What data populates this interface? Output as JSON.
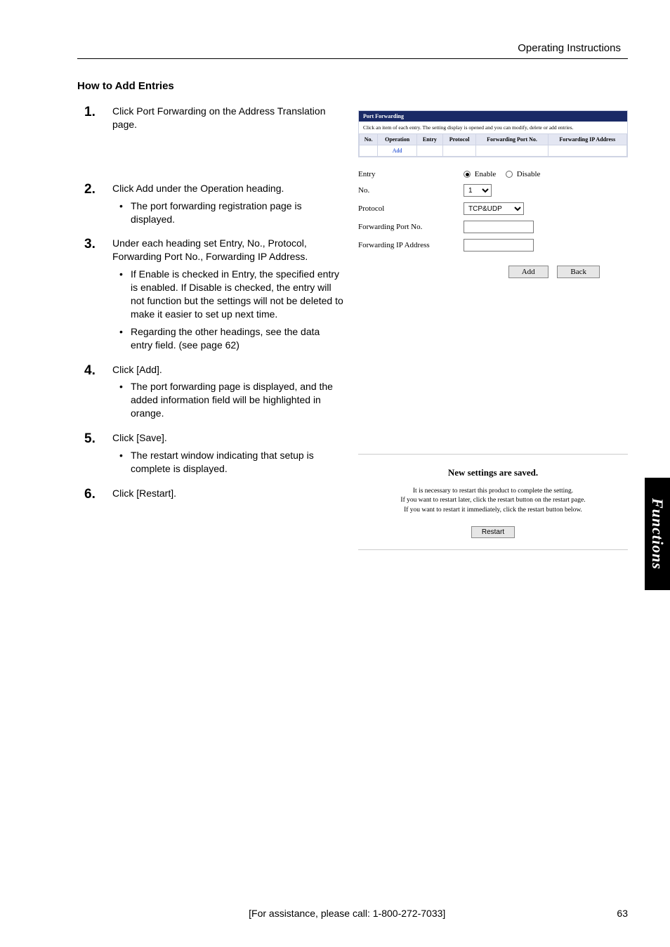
{
  "header": {
    "section": "Operating Instructions"
  },
  "title": "How to Add Entries",
  "steps": [
    {
      "lead": "Click Port Forwarding on the Address Translation page.",
      "bullets": []
    },
    {
      "lead": "Click Add under the Operation heading.",
      "bullets": [
        "The port forwarding registration page is displayed."
      ]
    },
    {
      "lead": "Under each heading set Entry, No., Protocol, Forwarding Port No., Forwarding IP Address.",
      "bullets": [
        "If Enable is checked in Entry, the specified entry is enabled. If Disable is checked, the entry will not function but the settings will not be deleted to make it easier to set up next time.",
        "Regarding the other headings, see the data entry field. (see page 62)"
      ]
    },
    {
      "lead": "Click [Add].",
      "bullets": [
        "The port forwarding page is displayed, and the added information field will be highlighted in orange."
      ]
    },
    {
      "lead": "Click [Save].",
      "bullets": [
        "The restart window indicating that setup is complete is displayed."
      ]
    },
    {
      "lead": "Click [Restart].",
      "bullets": []
    }
  ],
  "fig1": {
    "title": "Port Forwarding",
    "desc": "Click an item of each entry. The setting display is opened and you can modify, delete or add entries.",
    "cols": {
      "no": "No.",
      "operation": "Operation",
      "entry": "Entry",
      "protocol": "Protocol",
      "fport": "Forwarding Port No.",
      "fip": "Forwarding IP Address"
    },
    "addlink": "Add"
  },
  "fig2": {
    "labels": {
      "entry": "Entry",
      "no": "No.",
      "protocol": "Protocol",
      "fport": "Forwarding Port No.",
      "fip": "Forwarding IP Address"
    },
    "radios": {
      "enable": "Enable",
      "disable": "Disable"
    },
    "selects": {
      "no_value": "1",
      "protocol_value": "TCP&UDP"
    },
    "buttons": {
      "add": "Add",
      "back": "Back"
    }
  },
  "fig3": {
    "heading": "New settings are saved.",
    "line1": "It is necessary to restart this product to complete the setting.",
    "line2": "If you want to restart later, click the restart button on the restart page.",
    "line3": "If you want to restart it immediately, click the restart button below.",
    "button": "Restart"
  },
  "sidetab": "Functions",
  "footer": {
    "assist": "[For assistance, please call: 1-800-272-7033]",
    "page": "63"
  }
}
